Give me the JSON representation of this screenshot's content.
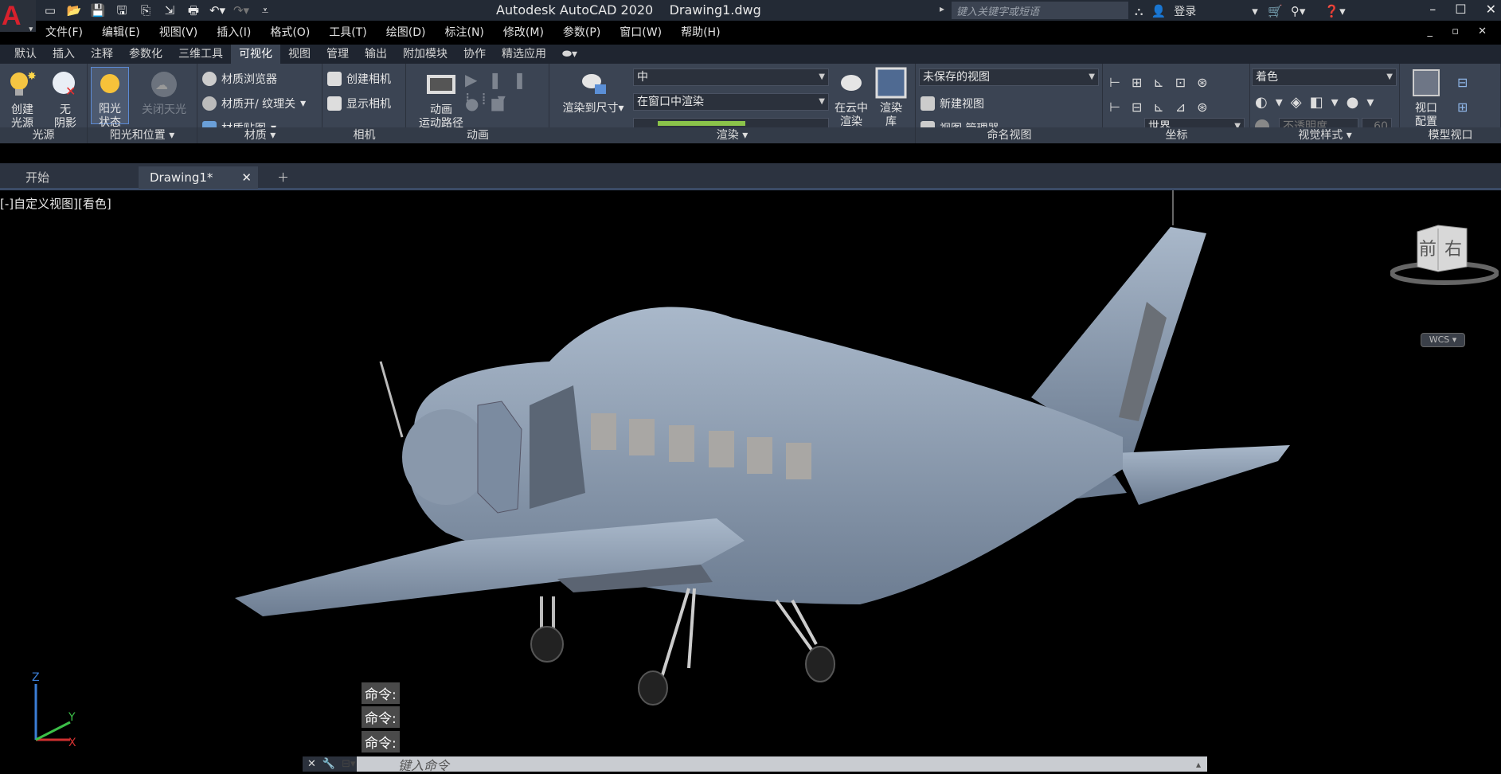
{
  "app": {
    "title": "Autodesk AutoCAD 2020    Drawing1.dwg",
    "logo": "A",
    "search_placeholder": "键入关键字或短语",
    "login": "登录"
  },
  "menu": [
    "文件(F)",
    "编辑(E)",
    "视图(V)",
    "插入(I)",
    "格式(O)",
    "工具(T)",
    "绘图(D)",
    "标注(N)",
    "修改(M)",
    "参数(P)",
    "窗口(W)",
    "帮助(H)"
  ],
  "ribbon_tabs": [
    {
      "label": "默认"
    },
    {
      "label": "插入"
    },
    {
      "label": "注释"
    },
    {
      "label": "参数化"
    },
    {
      "label": "三维工具"
    },
    {
      "label": "可视化"
    },
    {
      "label": "视图"
    },
    {
      "label": "管理"
    },
    {
      "label": "输出"
    },
    {
      "label": "附加模块"
    },
    {
      "label": "协作"
    },
    {
      "label": "精选应用"
    }
  ],
  "active_tab": "可视化",
  "ribbon": {
    "lights": {
      "create_label": "创建\n光源",
      "no_shadow_label": "无\n阴影",
      "panel": "光源"
    },
    "sun": {
      "sun_status": "阳光\n状态",
      "sky_off": "关闭天光",
      "panel": "阳光和位置"
    },
    "materials": {
      "browser": "材质浏览器",
      "on_off": "材质开/ 纹理关",
      "mapping": "材质贴图",
      "panel": "材质"
    },
    "camera": {
      "create": "创建相机",
      "show": "显示相机",
      "panel": "相机"
    },
    "animation": {
      "motion_path": "动画\n运动路径",
      "panel": "动画"
    },
    "render": {
      "render_to_size": "渲染到尺寸",
      "quality": "中",
      "render_in": "在窗口中渲染",
      "cloud": "在云中\n渲染",
      "gallery": "渲染\n库",
      "panel": "渲染"
    },
    "named_views": {
      "current": "未保存的视图",
      "new_view": "新建视图",
      "manager": "视图 管理器",
      "panel": "命名视图"
    },
    "coords": {
      "ucs": "世界",
      "panel": "坐标"
    },
    "visual_styles": {
      "style": "着色",
      "opacity_label": "不透明度",
      "opacity_value": "60",
      "panel": "视觉样式"
    },
    "model_viewports": {
      "config": "视口\n配置",
      "panel": "模型视口"
    }
  },
  "doc_tabs": {
    "start": "开始",
    "drawing": "Drawing1*"
  },
  "viewport": {
    "label": "[-]自定义视图][看色]",
    "viewcube_front": "前",
    "viewcube_right": "右",
    "wcs": "WCS",
    "axis_x": "X",
    "axis_y": "Y",
    "axis_z": "Z"
  },
  "command": {
    "history": [
      "命令:",
      "命令:",
      "命令:"
    ],
    "placeholder": "键入命令"
  },
  "colors": {
    "ribbon": "#3b4453",
    "titlebar": "#232a35",
    "model": "#8c9caf",
    "accent": "#d8212d"
  }
}
